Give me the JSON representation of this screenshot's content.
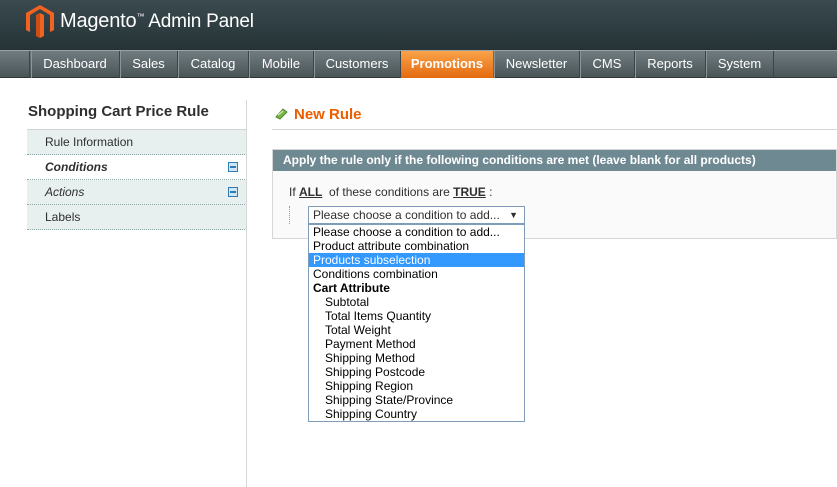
{
  "header": {
    "brand": "Magento",
    "tm": "™",
    "subtitle": "Admin Panel"
  },
  "nav": {
    "items": [
      {
        "label": "Dashboard",
        "active": false
      },
      {
        "label": "Sales",
        "active": false
      },
      {
        "label": "Catalog",
        "active": false
      },
      {
        "label": "Mobile",
        "active": false
      },
      {
        "label": "Customers",
        "active": false
      },
      {
        "label": "Promotions",
        "active": true
      },
      {
        "label": "Newsletter",
        "active": false
      },
      {
        "label": "CMS",
        "active": false
      },
      {
        "label": "Reports",
        "active": false
      },
      {
        "label": "System",
        "active": false
      }
    ]
  },
  "sidebar": {
    "title": "Shopping Cart Price Rule",
    "tabs": [
      {
        "label": "Rule Information"
      },
      {
        "label": "Conditions"
      },
      {
        "label": "Actions"
      },
      {
        "label": "Labels"
      }
    ]
  },
  "page": {
    "title": "New Rule"
  },
  "conditions": {
    "header": "Apply the rule only if the following conditions are met (leave blank for all products)",
    "if_text": "If",
    "aggregator": "ALL",
    "middle_text": "of these conditions are",
    "value": "TRUE",
    "colon": ":",
    "select_value": "Please choose a condition to add...",
    "select_arrow": "▼",
    "options": [
      {
        "label": "Please choose a condition to add..."
      },
      {
        "label": "Product attribute combination"
      },
      {
        "label": "Products subselection"
      },
      {
        "label": "Conditions combination"
      },
      {
        "label": "Cart Attribute"
      },
      {
        "label": "Subtotal"
      },
      {
        "label": "Total Items Quantity"
      },
      {
        "label": "Total Weight"
      },
      {
        "label": "Payment Method"
      },
      {
        "label": "Shipping Method"
      },
      {
        "label": "Shipping Postcode"
      },
      {
        "label": "Shipping Region"
      },
      {
        "label": "Shipping State/Province"
      },
      {
        "label": "Shipping Country"
      }
    ]
  },
  "colors": {
    "accent": "#eb5e00",
    "nav_active": "#f18200",
    "fieldset_header": "#6f8992",
    "option_highlight": "#3399ff"
  }
}
